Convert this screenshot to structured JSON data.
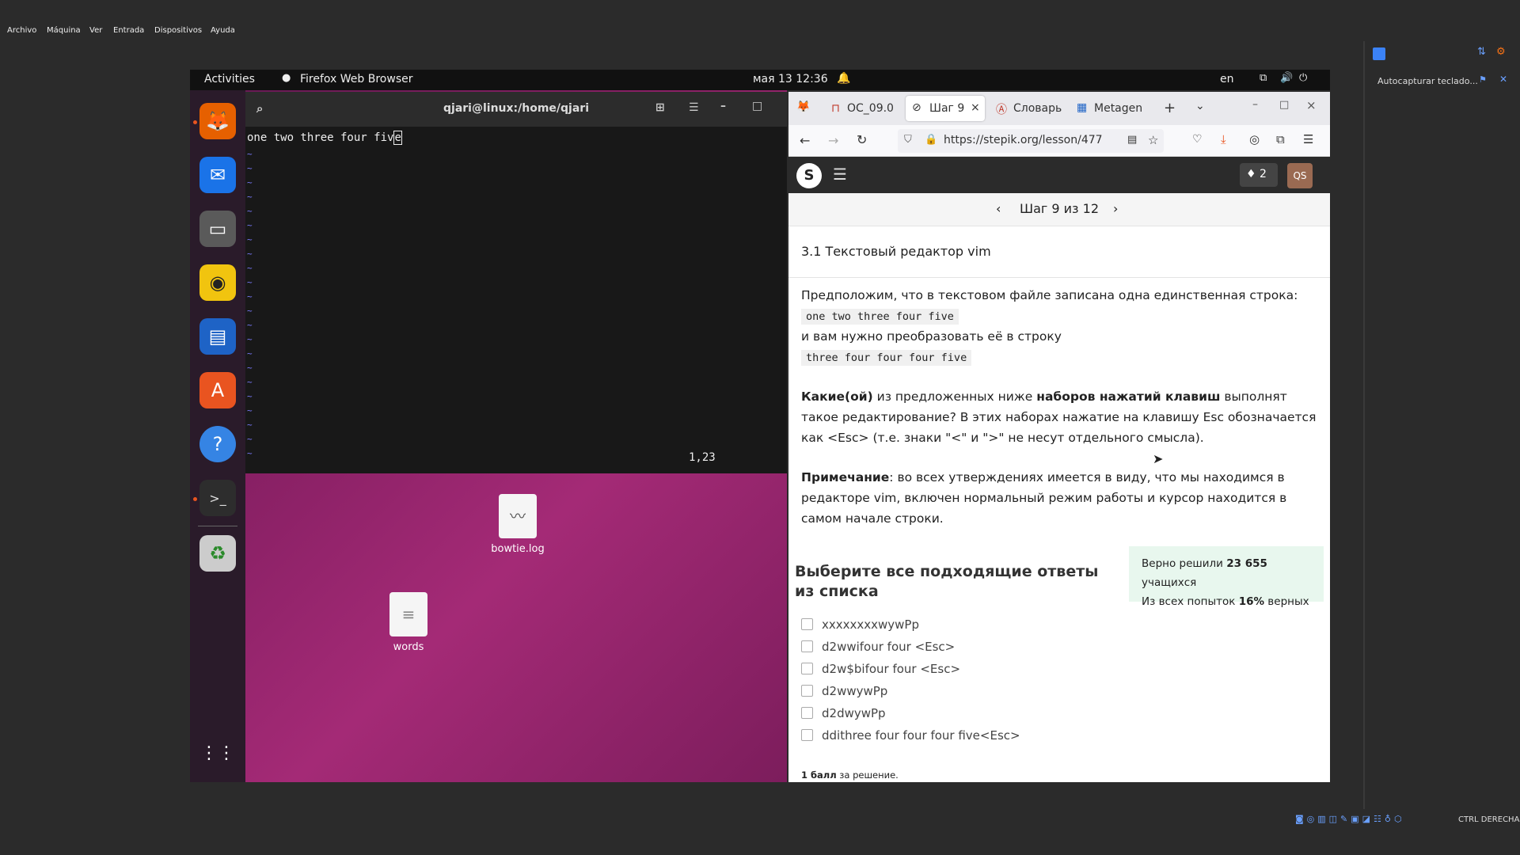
{
  "vbox_menu": [
    "Archivo",
    "Máquina",
    "Ver",
    "Entrada",
    "Dispositivos",
    "Ayuda"
  ],
  "topbar": {
    "activities": "Activities",
    "app_name": "Firefox Web Browser",
    "datetime": "мая 13  12:36",
    "lang": "en"
  },
  "dock": [
    "firefox-icon",
    "thunderbird-icon",
    "files-icon",
    "rhythmbox-icon",
    "writer-icon",
    "app-center-icon",
    "help-icon",
    "terminal-icon",
    "trash-icon",
    "app-grid-icon"
  ],
  "terminal": {
    "title": "qjari@linux:/home/qjari",
    "line": "one two three four fiv",
    "cursor_char": "e",
    "position": "1,23"
  },
  "desktop_files": [
    {
      "name": "bowtie.log"
    },
    {
      "name": "words"
    }
  ],
  "browser": {
    "tabs": [
      "ОС_09.0",
      "Шаг 9",
      "Словарь",
      "Metagen"
    ],
    "url": "https://stepik.org/lesson/477",
    "notifications": "2",
    "avatar": "QS"
  },
  "stepik": {
    "step_label": "Шаг 9 из 12",
    "lesson_title": "3.1 Текстовый редактор vim",
    "p1": "Предположим, что в текстовом файле записана одна единственная строка:",
    "code1": "one two three four five",
    "p2": "и вам нужно преобразовать её в строку",
    "code2": "three four four four five",
    "q_b1": "Какие(ой)",
    "q_t1": " из предложенных ниже ",
    "q_b2": "наборов нажатий клавиш",
    "q_t2": " выполнят такое редактирование? В этих наборах нажатие на клавишу Esc обозначается как <Esc> (т.е. знаки \"<\" и \">\" не несут отдельного смысла).",
    "note_b": "Примечание",
    "note_t": ": во всех утверждениях имеется в виду, что мы находимся в редакторе vim, включен нормальный режим работы и курсор находится в самом начале строки.",
    "select_heading": "Выберите все подходящие ответы из списка",
    "stats_l1_pre": "Верно решили ",
    "stats_l1_num": "23 655",
    "stats_l1_post": " учащихся",
    "stats_l2_pre": "Из всех попыток ",
    "stats_l2_num": "16%",
    "stats_l2_post": " верных",
    "options": [
      "xxxxxxxxwywPp",
      "d2wwifour four <Esc>",
      "d2w$bifour four <Esc>",
      "d2wwywPp",
      "d2dwywPp",
      "ddithree four four four five<Esc>"
    ],
    "score_b": "1 балл",
    "score_t": " за решение."
  },
  "right_panel": {
    "autocapture": "Autocapturar teclado..."
  },
  "statusbar": {
    "host_key": "CTRL DERECHA"
  }
}
